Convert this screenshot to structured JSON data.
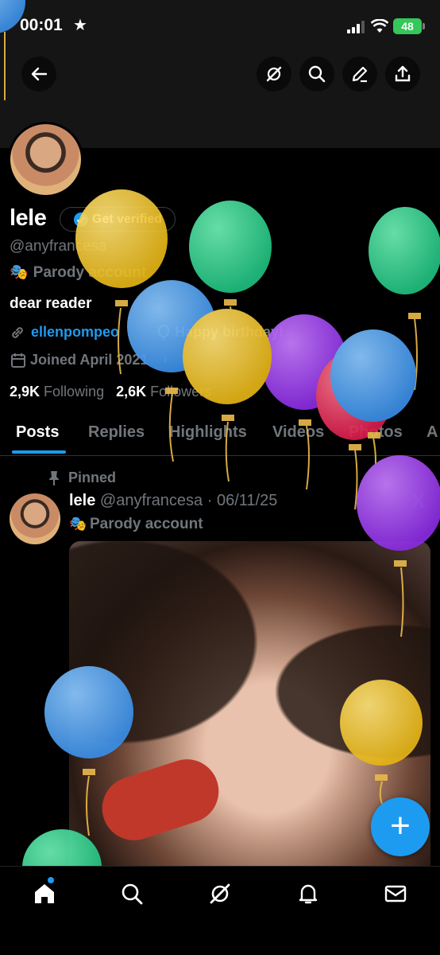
{
  "status_bar": {
    "time": "00:01",
    "battery": "48"
  },
  "header": {
    "back_icon": "arrow-left-icon",
    "grok_icon": "grok-icon",
    "search_icon": "search-icon",
    "edit_icon": "pencil-icon",
    "share_icon": "share-icon"
  },
  "profile": {
    "name": "lele",
    "get_verified": "Get verified",
    "handle": "@anyfrancesa",
    "parody_label": "Parody account",
    "bio": "dear reader",
    "link": "ellenpompeo",
    "birthday": "Happy birthday!",
    "joined": "Joined April 2021",
    "following_count": "2,9K",
    "following_label": "Following",
    "followers_count": "2,6K",
    "followers_label": "Followers"
  },
  "tabs": [
    "Posts",
    "Replies",
    "Highlights",
    "Videos",
    "Photos",
    "A"
  ],
  "post": {
    "pinned_label": "Pinned",
    "author": "lele",
    "handle": "@anyfrancesa",
    "separator": "·",
    "date": "06/11/25",
    "parody_label": "Parody account",
    "watermark": "X"
  },
  "fab_label": "+",
  "bottom_nav": [
    "home-icon",
    "search-icon",
    "grok-icon",
    "bell-icon",
    "mail-icon"
  ],
  "colors": {
    "accent": "#1d9bf0",
    "muted": "#71767b",
    "background": "#000000"
  }
}
